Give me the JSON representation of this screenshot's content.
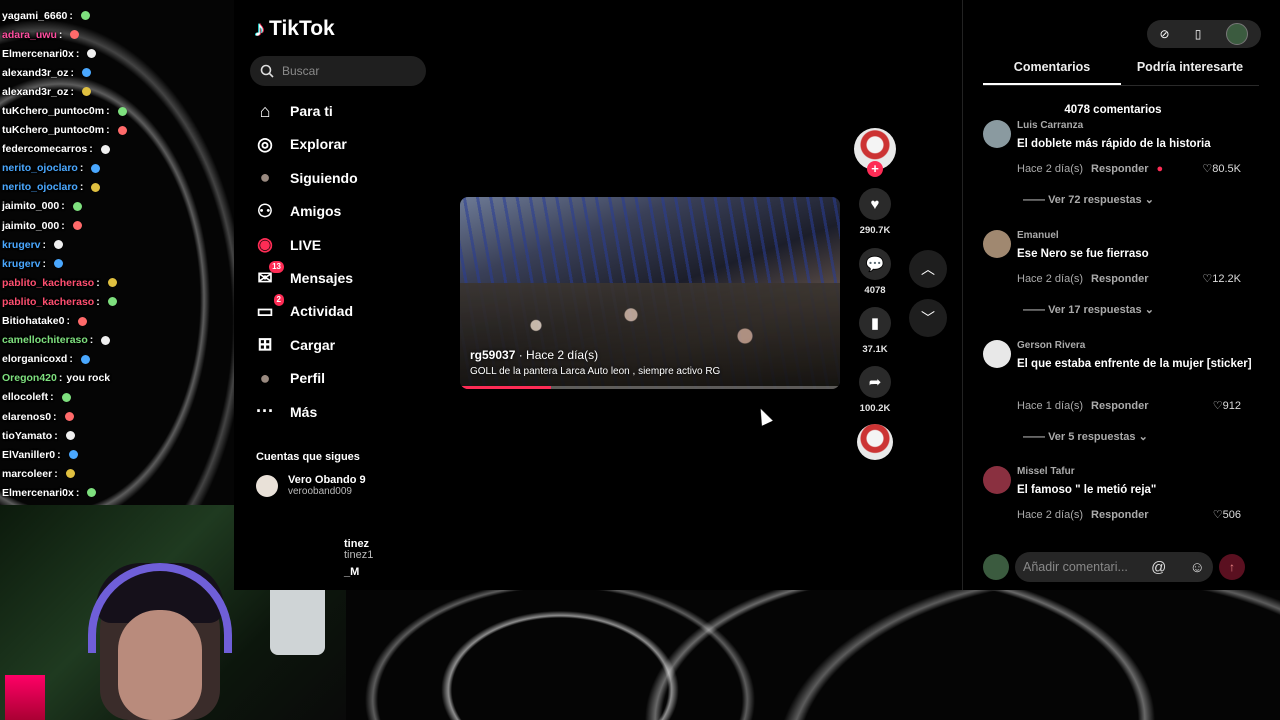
{
  "chat": [
    {
      "user": "yagami_6660",
      "msg": "",
      "color": "#ffffff"
    },
    {
      "user": "adara_uwu",
      "msg": "",
      "color": "#ff4fa0"
    },
    {
      "user": "Elmercenari0x",
      "msg": "",
      "color": "#ffffff"
    },
    {
      "user": "alexand3r_oz",
      "msg": "",
      "color": "#ffffff"
    },
    {
      "user": "alexand3r_oz",
      "msg": "",
      "color": "#ffffff"
    },
    {
      "user": "tuKchero_puntoc0m",
      "msg": "",
      "color": "#ffffff"
    },
    {
      "user": "tuKchero_puntoc0m",
      "msg": "",
      "color": "#ffffff"
    },
    {
      "user": "federcomecarros",
      "msg": "",
      "color": "#ffffff"
    },
    {
      "user": "nerito_ojoclaro",
      "msg": "",
      "color": "#4aa8ff"
    },
    {
      "user": "nerito_ojoclaro",
      "msg": "",
      "color": "#4aa8ff"
    },
    {
      "user": "jaimito_000",
      "msg": "",
      "color": "#ffffff"
    },
    {
      "user": "jaimito_000",
      "msg": "",
      "color": "#ffffff"
    },
    {
      "user": "krugerv",
      "msg": "",
      "color": "#4aa8ff"
    },
    {
      "user": "krugerv",
      "msg": "",
      "color": "#4aa8ff"
    },
    {
      "user": "pablito_kacheraso",
      "msg": "",
      "color": "#ff4f70"
    },
    {
      "user": "pablito_kacheraso",
      "msg": "",
      "color": "#ff4f70"
    },
    {
      "user": "Bitiohatake0",
      "msg": "",
      "color": "#ffffff"
    },
    {
      "user": "camellochiteraso",
      "msg": "",
      "color": "#7ee07e"
    },
    {
      "user": "elorganicoxd",
      "msg": "",
      "color": "#ffffff"
    },
    {
      "user": "Oregon420",
      "msg": "you rock",
      "color": "#7ee07e"
    },
    {
      "user": "ellocoleft",
      "msg": "",
      "color": "#ffffff"
    },
    {
      "user": "elarenos0",
      "msg": "",
      "color": "#ffffff"
    },
    {
      "user": "tioYamato",
      "msg": "",
      "color": "#ffffff"
    },
    {
      "user": "ElVaniller0",
      "msg": "",
      "color": "#ffffff"
    },
    {
      "user": "marcoleer",
      "msg": "",
      "color": "#ffffff"
    },
    {
      "user": "Elmercenari0x",
      "msg": "",
      "color": "#ffffff"
    }
  ],
  "app": {
    "name": "TikTok"
  },
  "search": {
    "placeholder": "Buscar"
  },
  "nav": [
    {
      "label": "Para ti",
      "icon": "home-icon"
    },
    {
      "label": "Explorar",
      "icon": "compass-icon"
    },
    {
      "label": "Siguiendo",
      "icon": "following-avatar-icon"
    },
    {
      "label": "Amigos",
      "icon": "friends-icon"
    },
    {
      "label": "LIVE",
      "icon": "live-icon"
    },
    {
      "label": "Mensajes",
      "icon": "messages-icon",
      "badge": "13"
    },
    {
      "label": "Actividad",
      "icon": "activity-icon",
      "badge": "2"
    },
    {
      "label": "Cargar",
      "icon": "upload-icon"
    },
    {
      "label": "Perfil",
      "icon": "profile-avatar-icon"
    },
    {
      "label": "Más",
      "icon": "more-icon"
    }
  ],
  "following": {
    "title": "Cuentas que sigues",
    "accounts": [
      {
        "name": "Vero Obando 9",
        "username": "verooband009"
      }
    ],
    "partial": [
      "tinez",
      "tinez1",
      "_M"
    ]
  },
  "video": {
    "author": "rg59037",
    "time": " · Hace 2 día(s)",
    "caption": "GOLL de la pantera Larca Auto leon , siempre activo RG",
    "progress": 0.24
  },
  "actions": {
    "likes": "290.7K",
    "comments": "4078",
    "saves": "37.1K",
    "shares": "100.2K"
  },
  "panel": {
    "tabs": [
      "Comentarios",
      "Podría interesarte"
    ],
    "count": "4078 comentarios",
    "comments": [
      {
        "user": "Luis Carranza",
        "text": "El doblete más rápido de la historia",
        "time": "Hace 2 día(s)",
        "reply": "Responder",
        "likes": "80.5K",
        "replies": "Ver 72 respuestas"
      },
      {
        "user": "Emanuel",
        "text": "Ese Nero se fue fierraso",
        "time": "Hace 2 día(s)",
        "reply": "Responder",
        "likes": "12.2K",
        "replies": "Ver 17 respuestas"
      },
      {
        "user": "Gerson Rivera",
        "text": "El que estaba enfrente de la mujer [sticker]",
        "time": "Hace 1 día(s)",
        "reply": "Responder",
        "likes": "912",
        "replies": "Ver 5 respuestas"
      },
      {
        "user": "Missel Tafur",
        "text": "El famoso \" le metió reja\"",
        "time": "Hace 2 día(s)",
        "reply": "Responder",
        "likes": "506"
      }
    ],
    "add_placeholder": "Añadir comentari..."
  },
  "colors": {
    "brand": "#fe2c55",
    "background": "#000000",
    "panel_input": "#262626"
  }
}
